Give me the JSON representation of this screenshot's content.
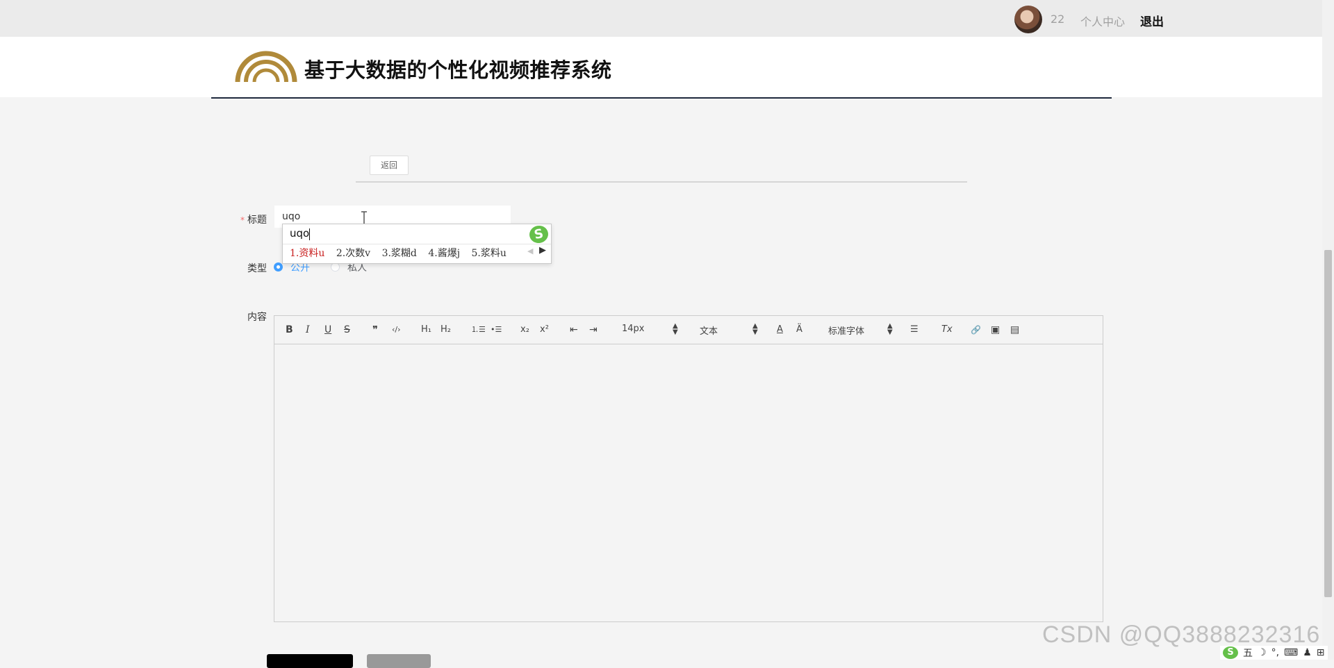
{
  "topbar": {
    "username": "22",
    "user_center": "个人中心",
    "logout": "退出"
  },
  "header": {
    "title": "基于大数据的个性化视频推荐系统"
  },
  "back_button": "返回",
  "form": {
    "title_label": "标题",
    "required_mark": "*",
    "title_value": "uqo",
    "type_label": "类型",
    "type_options": [
      "公开",
      "私人"
    ],
    "type_selected": "公开",
    "content_label": "内容"
  },
  "ime": {
    "input": "uqo",
    "candidates": [
      "1.资料u",
      "2.次数v",
      "3.浆糊d",
      "4.酱爆j",
      "5.浆料u"
    ],
    "logo": "S"
  },
  "editor": {
    "font_size": "14px",
    "header_select": "文本",
    "font_family": "标准字体",
    "tools": {
      "bold": "B",
      "italic": "I",
      "underline": "U",
      "strike": "S",
      "quote": "❞",
      "code": "‹/›",
      "h1": "H₁",
      "h2": "H₂",
      "ordered_list": "⒈☰",
      "bullet_list": "•☰",
      "subscript": "x₂",
      "superscript": "x²",
      "outdent": "⇤",
      "indent": "⇥",
      "color": "A",
      "background": "Ä",
      "align": "☰",
      "clean": "Tx",
      "link": "🔗",
      "image": "▣",
      "video": "▤"
    }
  },
  "watermark": "CSDN @QQ3888232316",
  "tray": {
    "ime_logo": "S",
    "items": [
      "五",
      "☽",
      "°,",
      "⌨",
      "♟",
      "⊞"
    ]
  },
  "colors": {
    "accent": "#409eff",
    "logo_gold": "#b08a3a",
    "header_line": "#1f2a3d",
    "required": "#f56c6c",
    "submit": "#000000",
    "reset": "#999999"
  }
}
